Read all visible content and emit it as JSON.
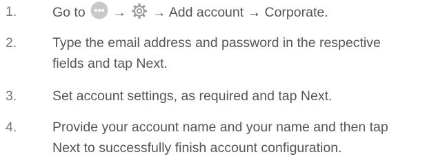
{
  "steps": [
    {
      "number": "1.",
      "go_to": "Go to",
      "icons": [
        "apps-icon",
        "settings-icon"
      ],
      "arrow": "→",
      "add_account": "Add account",
      "corporate": "Corporate."
    },
    {
      "number": "2.",
      "lines": [
        "Type the email address and password in the respective",
        "fields and tap Next."
      ]
    },
    {
      "number": "3.",
      "lines": [
        "Set account settings, as required and tap Next."
      ]
    },
    {
      "number": "4.",
      "lines": [
        "Provide your account name and your name and then tap",
        "Next to successfully finish account configuration."
      ]
    }
  ],
  "colors": {
    "text": "#555555",
    "apps_icon": "#c8c8c8",
    "settings_icon": "#9a9a9a"
  }
}
